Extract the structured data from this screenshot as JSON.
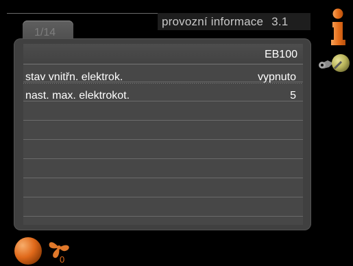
{
  "header": {
    "menu_title": "provozní informace",
    "menu_number": "3.1"
  },
  "tab": {
    "label": "1/14"
  },
  "panel": {
    "title": "EB100",
    "rows": [
      {
        "label": "stav vnitřn. elektrok.",
        "value": "vypnuto"
      },
      {
        "label": "nast. max. elektrokot.",
        "value": "5"
      }
    ]
  },
  "bottom": {
    "fan_number": "0"
  },
  "colors": {
    "accent": "#e0782a",
    "panel": "#404040",
    "background": "#000000"
  },
  "icons": {
    "info": "info-icon",
    "tools": "tools-icon",
    "globe": "globe-icon",
    "fan": "fan-icon"
  }
}
